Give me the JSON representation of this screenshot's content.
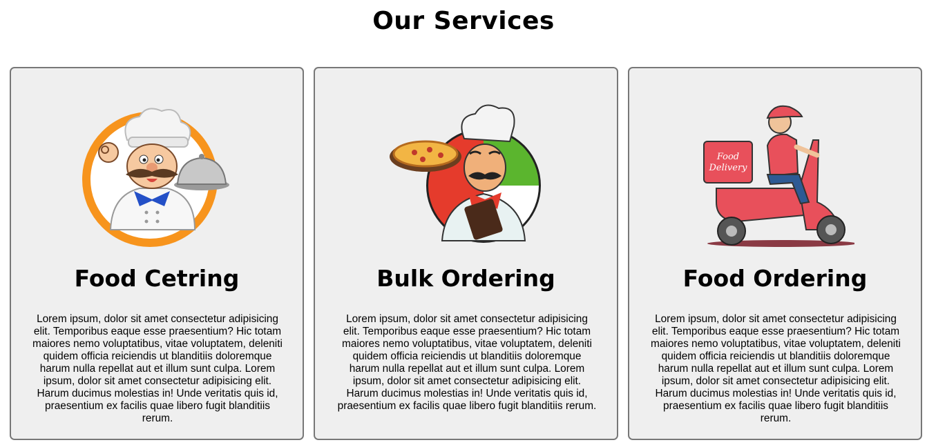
{
  "page": {
    "title": "Our Services"
  },
  "services": [
    {
      "icon": "chef-catering-icon",
      "title": "Food Cetring",
      "description": "Lorem ipsum, dolor sit amet consectetur adipisicing elit. Temporibus eaque esse praesentium? Hic totam maiores nemo voluptatibus, vitae voluptatem, deleniti quidem officia reiciendis ut blanditiis doloremque harum nulla repellat aut et illum sunt culpa. Lorem ipsum, dolor sit amet consectetur adipisicing elit. Harum ducimus molestias in! Unde veritatis quis id, praesentium ex facilis quae libero fugit blanditiis rerum."
    },
    {
      "icon": "pizza-chef-icon",
      "title": "Bulk Ordering",
      "description": "Lorem ipsum, dolor sit amet consectetur adipisicing elit. Temporibus eaque esse praesentium? Hic totam maiores nemo voluptatibus, vitae voluptatem, deleniti quidem officia reiciendis ut blanditiis doloremque harum nulla repellat aut et illum sunt culpa. Lorem ipsum, dolor sit amet consectetur adipisicing elit. Harum ducimus molestias in! Unde veritatis quis id, praesentium ex facilis quae libero fugit blanditiis rerum."
    },
    {
      "icon": "delivery-scooter-icon",
      "title": "Food Ordering",
      "description": "Lorem ipsum, dolor sit amet consectetur adipisicing elit. Temporibus eaque esse praesentium? Hic totam maiores nemo voluptatibus, vitae voluptatem, deleniti quidem officia reiciendis ut blanditiis doloremque harum nulla repellat aut et illum sunt culpa. Lorem ipsum, dolor sit amet consectetur adipisicing elit. Harum ducimus molestias in! Unde veritatis quis id, praesentium ex facilis quae libero fugit blanditiis rerum.",
      "logo_text": [
        "Food",
        "Delivery"
      ]
    }
  ],
  "colors": {
    "card_background": "#efefef",
    "card_border": "#777777",
    "catering_ring": "#f7941d",
    "scooter_red": "#e8505b"
  }
}
